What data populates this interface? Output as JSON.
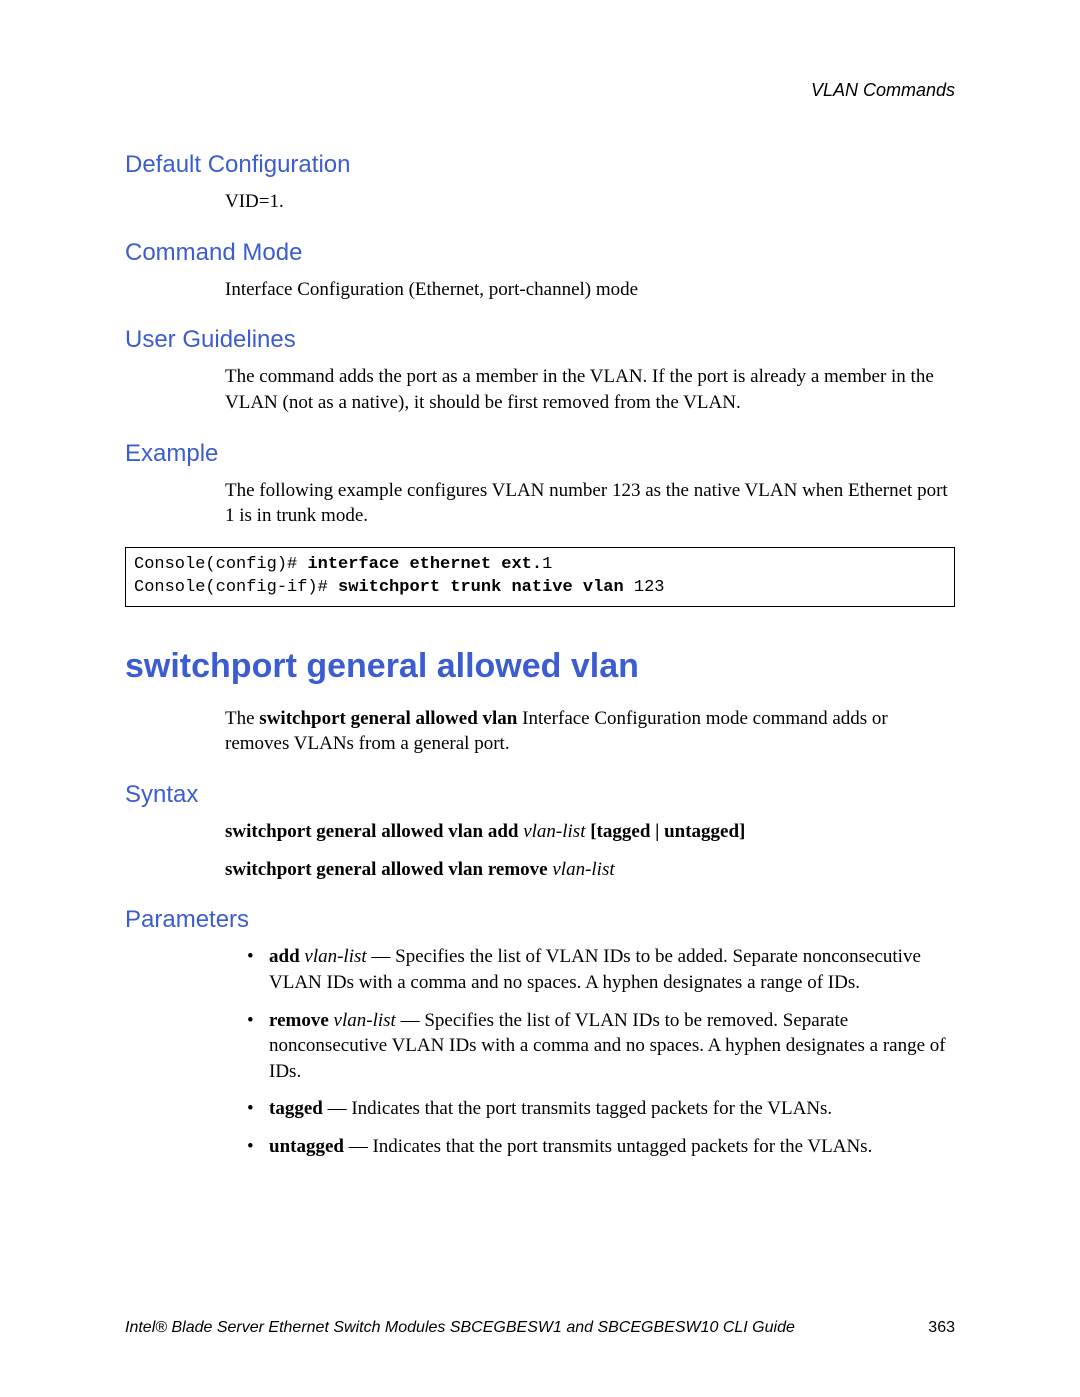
{
  "header": {
    "running": "VLAN Commands"
  },
  "sections": {
    "default_config": {
      "heading": "Default Configuration",
      "body": "VID=1."
    },
    "command_mode": {
      "heading": "Command Mode",
      "body": "Interface Configuration (Ethernet, port-channel) mode"
    },
    "user_guidelines": {
      "heading": "User Guidelines",
      "body": "The command adds the port as a member in the VLAN. If the port is already a member in the VLAN (not as a native), it should be first removed from the VLAN."
    },
    "example": {
      "heading": "Example",
      "intro": "The following example configures VLAN number 123 as the native VLAN when Ethernet port 1 is in trunk mode.",
      "code": {
        "line1_pre": "Console(config)# ",
        "line1_bold": "interface ethernet ext.",
        "line1_post": "1",
        "line2_pre": "Console(config-if)# ",
        "line2_bold": "switchport trunk native vlan ",
        "line2_post": "123"
      }
    }
  },
  "command": {
    "title": "switchport general allowed vlan",
    "desc_pre": "The ",
    "desc_bold": "switchport general allowed vlan",
    "desc_post": " Interface Configuration mode command adds or removes VLANs from a general port.",
    "syntax_heading": "Syntax",
    "syntax1": {
      "b1": "switchport general allowed vlan add ",
      "i1": "vlan-list ",
      "b2": "[tagged | untagged]"
    },
    "syntax2": {
      "b1": "switchport general allowed vlan remove ",
      "i1": "vlan-list"
    },
    "params_heading": "Parameters",
    "params": {
      "p1": {
        "b": "add ",
        "i": "vlan-list",
        "rest": " — Specifies the list of VLAN IDs to be added. Separate nonconsecutive VLAN IDs with a comma and no spaces. A hyphen designates a range of IDs."
      },
      "p2": {
        "b": "remove ",
        "i": "vlan-list",
        "rest": " — Specifies the list of VLAN IDs to be removed. Separate nonconsecutive VLAN IDs with a comma and no spaces. A hyphen designates a range of IDs."
      },
      "p3": {
        "b": "tagged",
        "rest": " — Indicates that the port transmits tagged packets for the VLANs."
      },
      "p4": {
        "b": "untagged",
        "rest": " — Indicates that the port transmits untagged packets for the VLANs."
      }
    }
  },
  "footer": {
    "text": "Intel® Blade Server Ethernet Switch Modules SBCEGBESW1 and SBCEGBESW10 CLI Guide",
    "page": "363"
  }
}
